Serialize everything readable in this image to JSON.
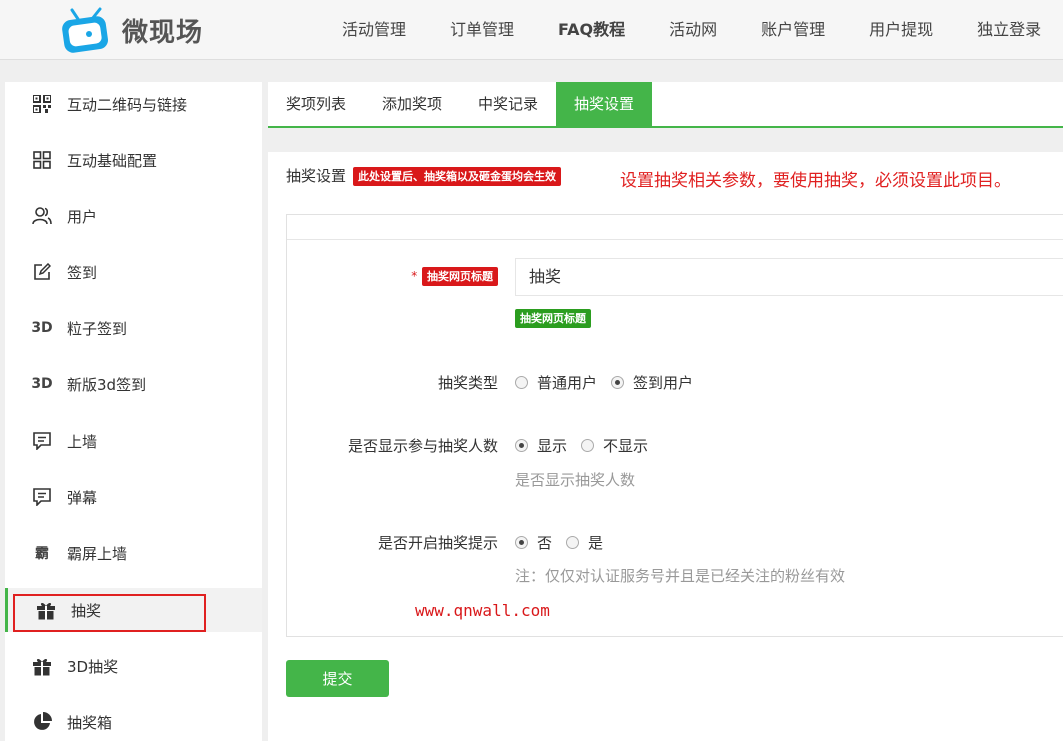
{
  "header": {
    "logo_text": "微现场",
    "nav": [
      {
        "label": "活动管理"
      },
      {
        "label": "订单管理"
      },
      {
        "label": "FAQ教程"
      },
      {
        "label": "活动网"
      },
      {
        "label": "账户管理"
      },
      {
        "label": "用户提现"
      },
      {
        "label": "独立登录"
      }
    ]
  },
  "sidebar": {
    "items": [
      {
        "label": "互动二维码与链接",
        "icon": "qrcode-icon"
      },
      {
        "label": "互动基础配置",
        "icon": "grid-icon"
      },
      {
        "label": "用户",
        "icon": "users-icon"
      },
      {
        "label": "签到",
        "icon": "edit-icon"
      },
      {
        "label": "粒子签到",
        "icon": "3d-icon",
        "icon_text": "3D"
      },
      {
        "label": "新版3d签到",
        "icon": "3d-icon",
        "icon_text": "3D"
      },
      {
        "label": "上墙",
        "icon": "message-icon"
      },
      {
        "label": "弹幕",
        "icon": "message-icon"
      },
      {
        "label": "霸屏上墙",
        "icon": "ba-icon",
        "icon_text": "霸"
      },
      {
        "label": "抽奖",
        "icon": "gift-icon"
      },
      {
        "label": "3D抽奖",
        "icon": "gift-icon"
      },
      {
        "label": "抽奖箱",
        "icon": "pie-chart-icon"
      }
    ],
    "active_index": 9
  },
  "tabs": [
    {
      "label": "奖项列表"
    },
    {
      "label": "添加奖项"
    },
    {
      "label": "中奖记录"
    },
    {
      "label": "抽奖设置"
    }
  ],
  "active_tab": 3,
  "panel": {
    "title": "抽奖设置",
    "title_badge": "此处设置后、抽奖箱以及砸金蛋均会生效",
    "annotation": "设置抽奖相关参数，要使用抽奖，必须设置此项目。"
  },
  "form": {
    "page_title": {
      "required_mark": "*",
      "label_badge": "抽奖网页标题",
      "value": "抽奖",
      "hint_badge": "抽奖网页标题"
    },
    "lottery_type": {
      "label": "抽奖类型",
      "options": [
        {
          "label": "普通用户",
          "checked": false
        },
        {
          "label": "签到用户",
          "checked": true
        }
      ]
    },
    "show_count": {
      "label": "是否显示参与抽奖人数",
      "options": [
        {
          "label": "显示",
          "checked": true
        },
        {
          "label": "不显示",
          "checked": false
        }
      ],
      "hint": "是否显示抽奖人数"
    },
    "prompt": {
      "label": "是否开启抽奖提示",
      "options": [
        {
          "label": "否",
          "checked": true
        },
        {
          "label": "是",
          "checked": false
        }
      ],
      "hint": "注：仅仅对认证服务号并且是已经关注的粉丝有效"
    },
    "watermark": "www.qnwall.com"
  },
  "submit_label": "提交",
  "colors": {
    "accent": "#44b549",
    "red": "#d9181a",
    "logo_blue": "#1aa6e6"
  }
}
